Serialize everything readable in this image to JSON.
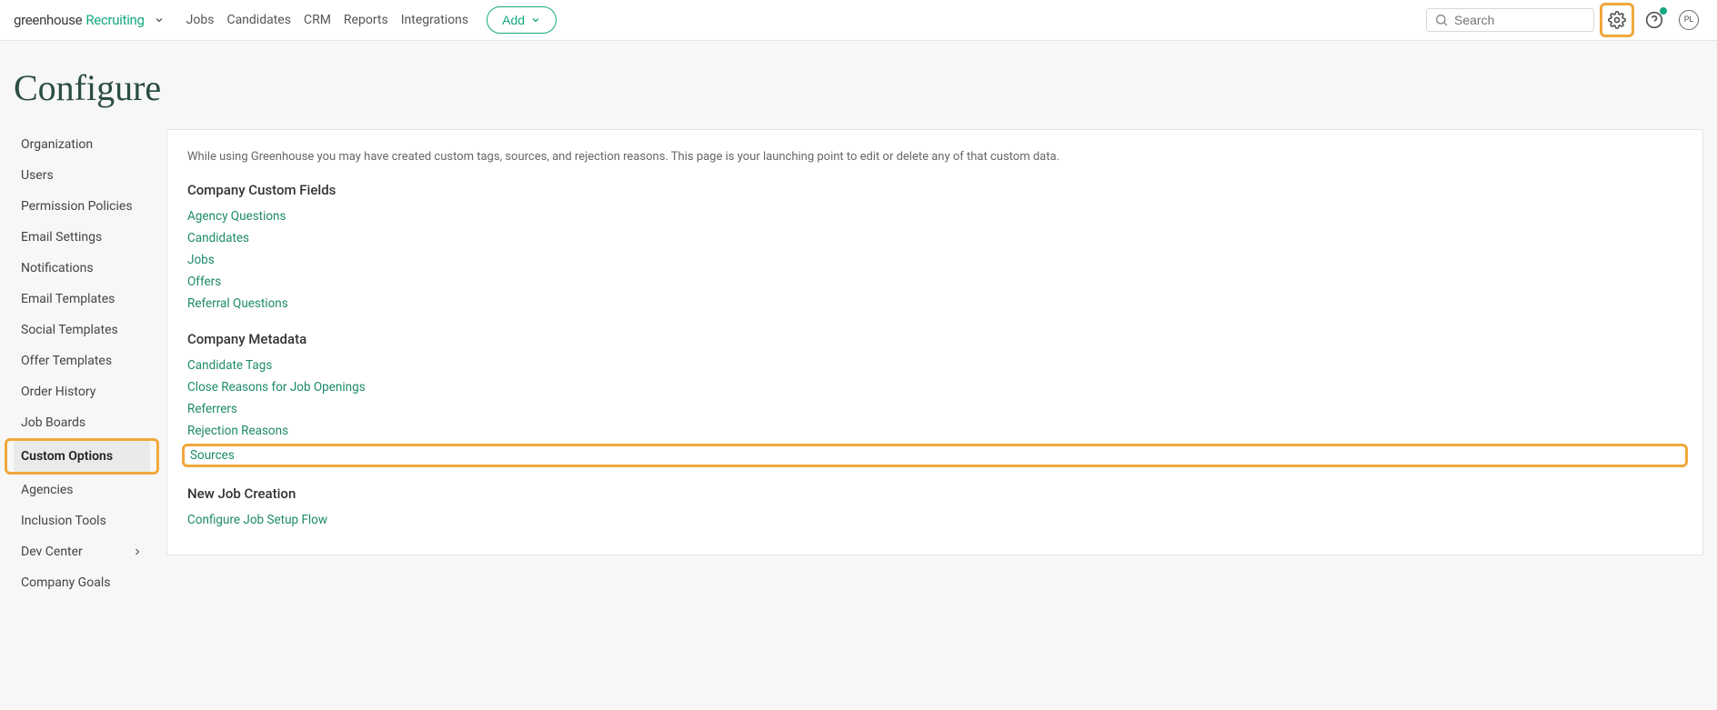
{
  "header": {
    "brand_part1": "greenhouse",
    "brand_part2": "Recruiting",
    "nav": [
      "Jobs",
      "Candidates",
      "CRM",
      "Reports",
      "Integrations"
    ],
    "add_label": "Add",
    "search_placeholder": "Search",
    "avatar_initials": "PL"
  },
  "page": {
    "title": "Configure"
  },
  "sidebar": {
    "items": [
      "Organization",
      "Users",
      "Permission Policies",
      "Email Settings",
      "Notifications",
      "Email Templates",
      "Social Templates",
      "Offer Templates",
      "Order History",
      "Job Boards",
      "Custom Options",
      "Agencies",
      "Inclusion Tools",
      "Dev Center",
      "Company Goals"
    ],
    "active_index": 10,
    "highlighted_index": 10,
    "expandable_index": 13
  },
  "main": {
    "intro": "While using Greenhouse you may have created custom tags, sources, and rejection reasons. This page is your launching point to edit or delete any of that custom data.",
    "sections": [
      {
        "title": "Company Custom Fields",
        "links": [
          "Agency Questions",
          "Candidates",
          "Jobs",
          "Offers",
          "Referral Questions"
        ]
      },
      {
        "title": "Company Metadata",
        "links": [
          "Candidate Tags",
          "Close Reasons for Job Openings",
          "Referrers",
          "Rejection Reasons",
          "Sources"
        ],
        "highlighted_link_index": 4
      },
      {
        "title": "New Job Creation",
        "links": [
          "Configure Job Setup Flow"
        ]
      }
    ]
  }
}
